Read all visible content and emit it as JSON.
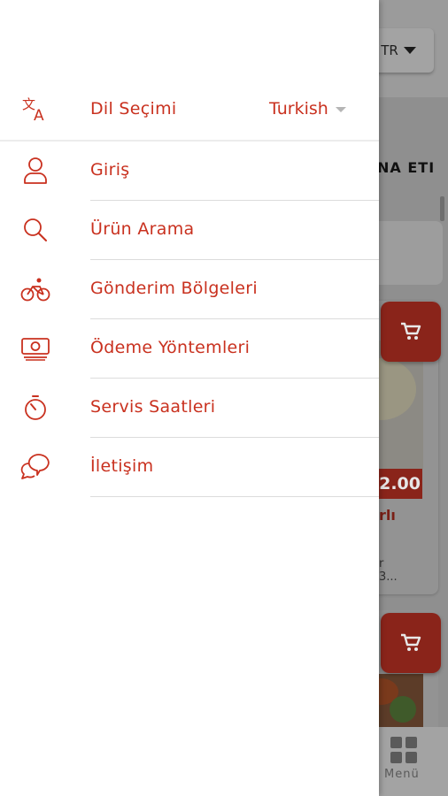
{
  "background": {
    "language_button": "TR",
    "category_label": "NA ETI",
    "price": "2.00",
    "product_name": "rlı",
    "product_desc_line1": "r",
    "product_desc_line2": "3...",
    "bottom_menu_label": "Menü"
  },
  "drawer": {
    "language": {
      "label": "Dil Seçimi",
      "value": "Turkish",
      "icon": "translate-icon"
    },
    "items": [
      {
        "label": "Giriş",
        "icon": "user-icon"
      },
      {
        "label": "Ürün Arama",
        "icon": "search-icon"
      },
      {
        "label": "Gönderim Bölgeleri",
        "icon": "bicycle-icon"
      },
      {
        "label": "Ödeme Yöntemleri",
        "icon": "money-icon"
      },
      {
        "label": "Servis Saatleri",
        "icon": "timer-icon"
      },
      {
        "label": "İletişim",
        "icon": "chat-icon"
      }
    ]
  },
  "colors": {
    "accent": "#c9311f",
    "dim_accent": "#8a241a"
  }
}
